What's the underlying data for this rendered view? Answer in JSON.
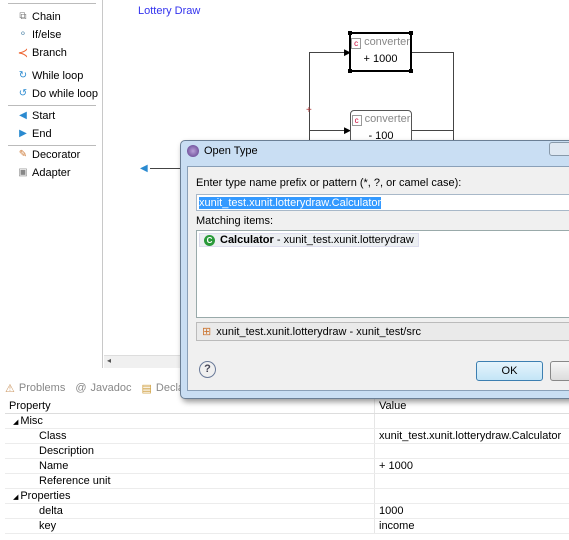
{
  "palette": {
    "items": [
      {
        "label": "Chain",
        "icon": "chain-icon"
      },
      {
        "label": "If/else",
        "icon": "ifelse-icon"
      },
      {
        "label": "Branch",
        "icon": "branch-icon"
      },
      {
        "label": "While loop",
        "icon": "while-loop-icon"
      },
      {
        "label": "Do while loop",
        "icon": "do-while-loop-icon"
      },
      {
        "label": "Start",
        "icon": "start-icon"
      },
      {
        "label": "End",
        "icon": "end-icon"
      },
      {
        "label": "Decorator",
        "icon": "decorator-icon"
      },
      {
        "label": "Adapter",
        "icon": "adapter-icon"
      }
    ]
  },
  "canvas": {
    "title": "Lottery Draw",
    "branch_marker": "+",
    "nodes": [
      {
        "type": "converter",
        "value": "+ 1000",
        "selected": true
      },
      {
        "type": "converter",
        "value": "- 100"
      }
    ]
  },
  "dialog": {
    "title": "Open Type",
    "prompt": "Enter type name prefix or pattern (*, ?, or camel case):",
    "input_value": "xunit_test.xunit.lotterydraw.Calculator",
    "matching_label": "Matching items:",
    "match": {
      "name": "Calculator",
      "package": " - xunit_test.xunit.lotterydraw"
    },
    "status": "xunit_test.xunit.lotterydraw - xunit_test/src",
    "help": "?",
    "ok_label": "OK"
  },
  "bottom": {
    "tabs": [
      "Problems",
      "Javadoc",
      "Declaration"
    ],
    "header": {
      "property": "Property",
      "value": "Value"
    },
    "rows": [
      {
        "k": "Misc",
        "v": "",
        "group": true
      },
      {
        "k": "Class",
        "v": "xunit_test.xunit.lotterydraw.Calculator"
      },
      {
        "k": "Description",
        "v": ""
      },
      {
        "k": "Name",
        "v": "+ 1000"
      },
      {
        "k": "Reference unit",
        "v": ""
      },
      {
        "k": "Properties",
        "v": "",
        "group": true
      },
      {
        "k": "delta",
        "v": "1000"
      },
      {
        "k": "key",
        "v": "income"
      }
    ]
  }
}
